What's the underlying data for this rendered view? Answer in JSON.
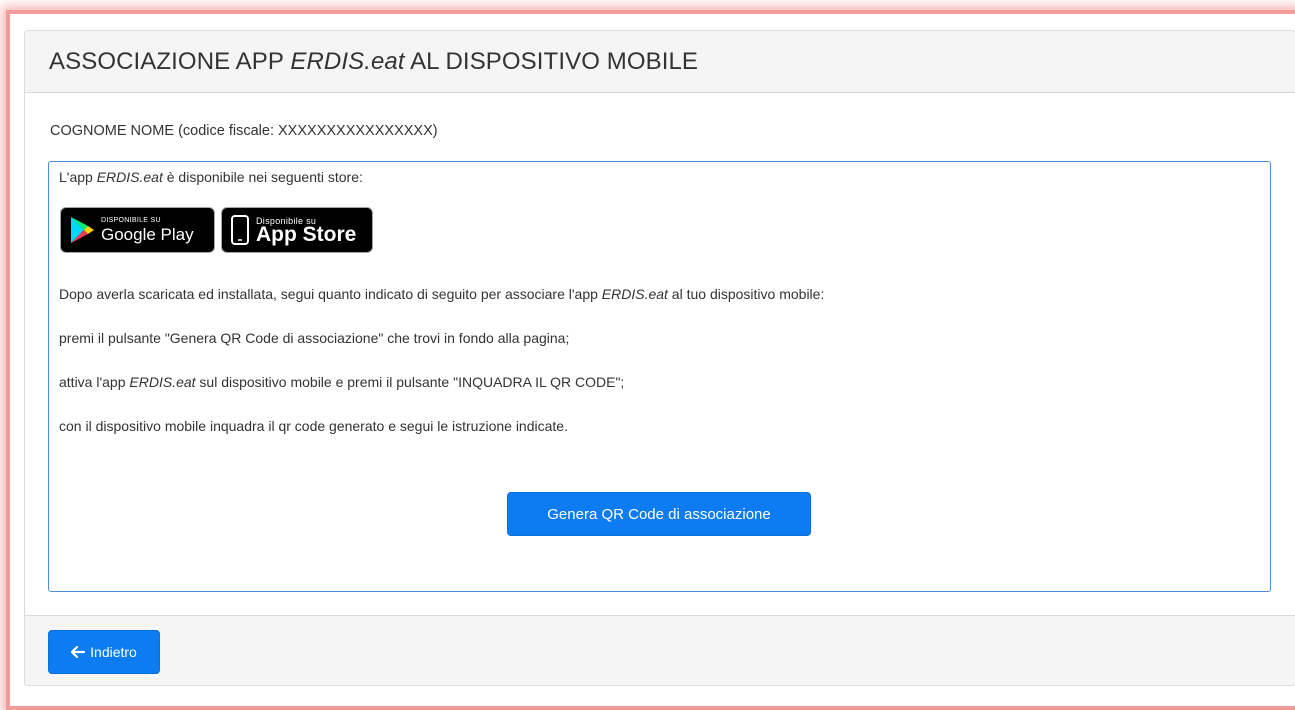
{
  "header": {
    "title_prefix": "ASSOCIAZIONE APP ",
    "title_app": "ERDIS.eat",
    "title_suffix": " AL DISPOSITIVO MOBILE"
  },
  "user": {
    "line": "COGNOME NOME (codice fiscale: XXXXXXXXXXXXXXXX)"
  },
  "info": {
    "intro_prefix": "L'app ",
    "intro_app": "ERDIS.eat",
    "intro_suffix": " è disponibile nei seguenti store:",
    "step0_prefix": "Dopo averla scaricata ed installata, segui quanto indicato di seguito per associare l'app ",
    "step0_app": "ERDIS.eat",
    "step0_suffix": " al tuo dispositivo mobile:",
    "step1": "premi il pulsante \"Genera QR Code di associazione\" che trovi in fondo alla pagina;",
    "step2_prefix": "attiva l'app ",
    "step2_app": "ERDIS.eat",
    "step2_suffix": " sul dispositivo mobile e premi il pulsante \"INQUADRA IL QR CODE\";",
    "step3": "con il dispositivo mobile inquadra il qr code generato e segui le istruzione indicate."
  },
  "badges": {
    "google_small": "DISPONIBILE SU",
    "google_big": "Google Play",
    "apple_small": "Disponibile su",
    "apple_big": "App Store",
    "google_icon": "google-play-icon",
    "apple_icon": "phone-icon"
  },
  "actions": {
    "generate_qr_label": "Genera QR Code di associazione",
    "back_label": "Indietro",
    "back_icon": "arrow-left-icon"
  },
  "colors": {
    "primary": "#0d7cf2",
    "info_border": "#4a90d9",
    "frame_glow": "#f29b9b"
  }
}
